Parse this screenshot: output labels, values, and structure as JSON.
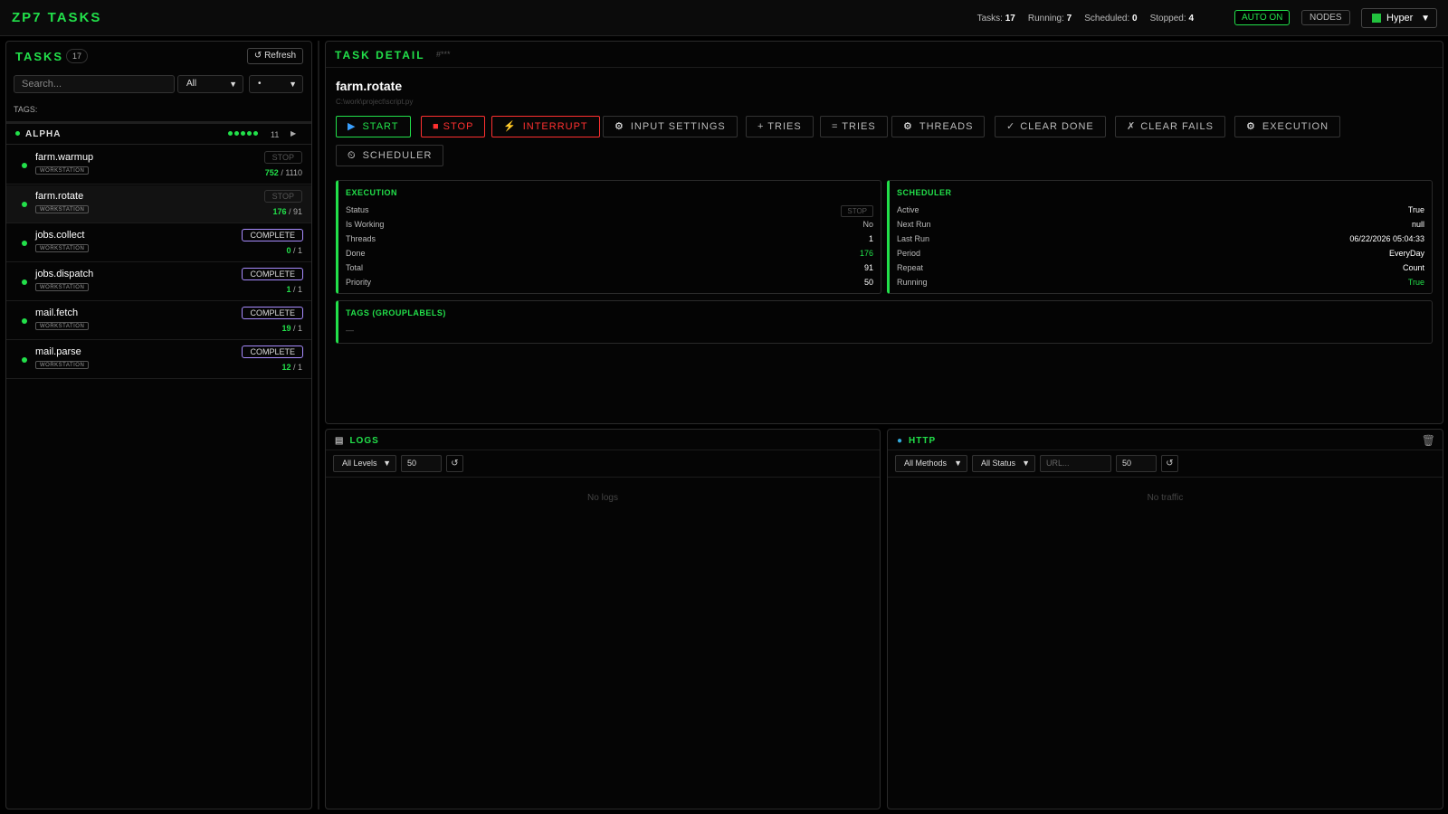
{
  "app": {
    "title": "ZP7 TASKS"
  },
  "stats": {
    "tasks_label": "Tasks:",
    "tasks": "17",
    "running_label": "Running:",
    "running": "7",
    "scheduled_label": "Scheduled:",
    "scheduled": "0",
    "stopped_label": "Stopped:",
    "stopped": "4"
  },
  "header": {
    "auto_label": "AUTO ON",
    "nodes_label": "NODES",
    "profile": "Hyper"
  },
  "sidebar": {
    "title": "TASKS",
    "count": "17",
    "refresh_label": "↺ Refresh",
    "search_placeholder": "Search...",
    "filter1": "All",
    "filter2": "•",
    "tags_label": "TAGS:",
    "group": {
      "name": "ALPHA",
      "count": "11"
    },
    "tasks": [
      {
        "name": "farm.warmup",
        "tag": "WORKSTATION",
        "badge": "STOP",
        "done": "752",
        "total": "/ 1110"
      },
      {
        "name": "farm.rotate",
        "tag": "WORKSTATION",
        "badge": "STOP",
        "done": "176",
        "total": "/ 91"
      },
      {
        "name": "jobs.collect",
        "tag": "WORKSTATION",
        "badge": "COMPLETE",
        "done": "0",
        "total": "/ 1"
      },
      {
        "name": "jobs.dispatch",
        "tag": "WORKSTATION",
        "badge": "COMPLETE",
        "done": "1",
        "total": "/ 1"
      },
      {
        "name": "mail.fetch",
        "tag": "WORKSTATION",
        "badge": "COMPLETE",
        "done": "19",
        "total": "/ 1"
      },
      {
        "name": "mail.parse",
        "tag": "WORKSTATION",
        "badge": "COMPLETE",
        "done": "12",
        "total": "/ 1"
      }
    ]
  },
  "detail": {
    "title": "TASK DETAIL",
    "hash": "#***",
    "task_name": "farm.rotate",
    "path": "C:\\work\\project\\script.py",
    "actions": {
      "start": "START",
      "stop": "STOP",
      "interrupt": "INTERRUPT",
      "input_settings": "INPUT SETTINGS",
      "plus_tries": "+ TRIES",
      "eq_tries": "= TRIES",
      "threads": "THREADS",
      "clear_done": "CLEAR DONE",
      "clear_fails": "CLEAR FAILS",
      "execution": "EXECUTION",
      "scheduler": "SCHEDULER"
    },
    "execution": {
      "title": "EXECUTION",
      "rows": [
        {
          "k": "Status",
          "v": "STOP"
        },
        {
          "k": "Is Working",
          "v": "No"
        },
        {
          "k": "Threads",
          "v": "1"
        },
        {
          "k": "Done",
          "v": "176"
        },
        {
          "k": "Total",
          "v": "91"
        },
        {
          "k": "Priority",
          "v": "50"
        }
      ]
    },
    "scheduler": {
      "title": "SCHEDULER",
      "rows": [
        {
          "k": "Active",
          "v": "True"
        },
        {
          "k": "Next Run",
          "v": "null"
        },
        {
          "k": "Last Run",
          "v": "06/22/2026 05:04:33"
        },
        {
          "k": "Period",
          "v": "EveryDay"
        },
        {
          "k": "Repeat",
          "v": "Count"
        },
        {
          "k": "Running",
          "v": "True"
        }
      ]
    },
    "tags": {
      "title": "TAGS (GROUPLABELS)",
      "value": "—"
    }
  },
  "logs": {
    "title": "LOGS",
    "level": "All Levels",
    "limit": "50",
    "refresh": "↺",
    "empty": "No logs"
  },
  "http": {
    "title": "HTTP",
    "methods": "All Methods",
    "status": "All Status",
    "url_placeholder": "URL...",
    "limit": "50",
    "refresh": "↺",
    "empty": "No traffic"
  },
  "colors": {
    "accent": "#22e04a",
    "danger": "#ff3030",
    "complete": "#a88cff"
  }
}
